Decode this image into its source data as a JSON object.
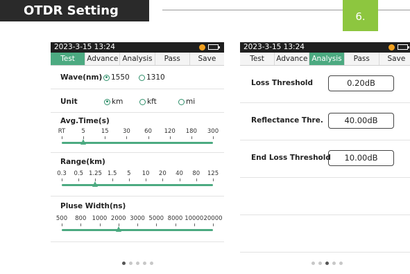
{
  "header": {
    "title": "OTDR Setting",
    "page_number": "6."
  },
  "left_panel": {
    "status": {
      "datetime": "2023-3-15 13:24"
    },
    "tabs": [
      "Test",
      "Advance",
      "Analysis",
      "Pass",
      "Save"
    ],
    "active_tab": "Test",
    "wave": {
      "label": "Wave(nm)",
      "options": [
        "1550",
        "1310"
      ],
      "selected": "1550"
    },
    "unit": {
      "label": "Unit",
      "options": [
        "km",
        "kft",
        "mi"
      ],
      "selected": "km"
    },
    "avg_time": {
      "label": "Avg.Time(s)",
      "ticks": [
        "RT",
        "5",
        "15",
        "30",
        "60",
        "120",
        "180",
        "300"
      ],
      "selected_index": 1
    },
    "range": {
      "label": "Range(km)",
      "ticks": [
        "0.3",
        "0.5",
        "1.25",
        "1.5",
        "5",
        "10",
        "20",
        "40",
        "80",
        "125"
      ],
      "selected_index": 2
    },
    "pulse": {
      "label": "Pluse Width(ns)",
      "ticks": [
        "500",
        "800",
        "1000",
        "2000",
        "3000",
        "5000",
        "8000",
        "10000",
        "20000"
      ],
      "selected_index": 3
    },
    "page_dots": {
      "count": 5,
      "active": 0
    }
  },
  "right_panel": {
    "status": {
      "datetime": "2023-3-15 13:24"
    },
    "tabs": [
      "Test",
      "Advance",
      "Analysis",
      "Pass",
      "Save"
    ],
    "active_tab": "Analysis",
    "fields": [
      {
        "label": "Loss Threshold",
        "value": "0.20dB"
      },
      {
        "label": "Reflectance Thre.",
        "value": "40.00dB"
      },
      {
        "label": "End Loss Threshold",
        "value": "10.00dB"
      }
    ],
    "page_dots": {
      "count": 5,
      "active": 2
    }
  },
  "colors": {
    "accent": "#4caa81",
    "page_badge": "#8dc63f",
    "banner": "#2a2a2a"
  }
}
